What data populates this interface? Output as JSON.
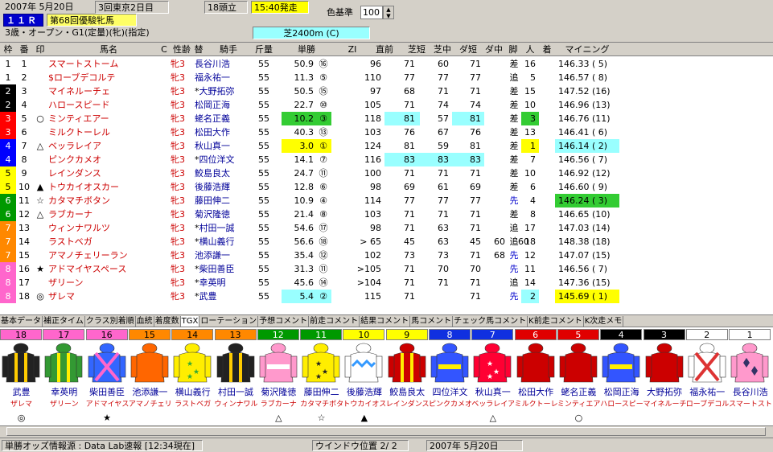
{
  "race_info": {
    "date": "2007年 5月20日",
    "meeting": "3回東京2日目",
    "race_no": "１１Ｒ",
    "race_name": "第68回優駿牝馬",
    "conditions": "3歳・オープン・G1(定量)(牝)(指定)",
    "field_size": "18頭立",
    "start_time": "15:40発走",
    "color_label": "色基準",
    "color_value": "100",
    "course": "芝2400m (C)"
  },
  "columns": [
    "枠",
    "番",
    "印",
    "馬名",
    "C",
    "性齢",
    "替",
    "騎手",
    "斤量",
    "単勝",
    "ZI",
    "直前",
    "芝短",
    "芝中",
    "ダ短",
    "ダ中",
    "脚",
    "人",
    "着",
    "マイニング"
  ],
  "horses": [
    {
      "waku": "1",
      "uma": "1",
      "mark": "",
      "name": "スマートストーム",
      "sexage": "牝3",
      "kae": "",
      "jockey": "長谷川浩",
      "kin": "55",
      "odds": "50.9",
      "pop_m": "⑯",
      "zi": "96",
      "c1": "71",
      "c2": "60",
      "c3": "71",
      "c4": "",
      "c5": "",
      "ky": "差",
      "pop": "16",
      "fin": "",
      "mining": "146.33 ( 5)"
    },
    {
      "waku": "1",
      "uma": "2",
      "mark": "",
      "name": "$ローブデコルテ",
      "sexage": "牝3",
      "kae": "",
      "jockey": "福永祐一",
      "kin": "55",
      "odds": "11.3",
      "pop_m": "⑤",
      "zi": "110",
      "c1": "77",
      "c2": "77",
      "c3": "77",
      "c4": "",
      "c5": "",
      "ky": "追",
      "pop": "5",
      "fin": "",
      "mining": "146.57 ( 8)"
    },
    {
      "waku": "2",
      "uma": "3",
      "mark": "",
      "name": "マイネルーチェ",
      "sexage": "牝3",
      "kae": "*",
      "jockey": "大野拓弥",
      "kin": "55",
      "odds": "50.5",
      "pop_m": "⑮",
      "zi": "97",
      "c1": "68",
      "c2": "71",
      "c3": "71",
      "c4": "",
      "c5": "",
      "ky": "差",
      "pop": "15",
      "fin": "",
      "mining": "147.52 (16)"
    },
    {
      "waku": "2",
      "uma": "4",
      "mark": "",
      "name": "ハロースピード",
      "sexage": "牝3",
      "kae": "",
      "jockey": "松岡正海",
      "kin": "55",
      "odds": "22.7",
      "pop_m": "⑩",
      "zi": "105",
      "c1": "71",
      "c2": "74",
      "c3": "74",
      "c4": "",
      "c5": "",
      "ky": "差",
      "pop": "10",
      "fin": "",
      "mining": "146.96 (13)"
    },
    {
      "waku": "3",
      "uma": "5",
      "mark": "○",
      "name": "ミンティエアー",
      "sexage": "牝3",
      "kae": "",
      "jockey": "蛯名正義",
      "kin": "55",
      "odds": "10.2",
      "pop_m": "③",
      "zi": "118",
      "c1": "81",
      "c2": "57",
      "c3": "81",
      "c4": "",
      "c5": "",
      "ky": "差",
      "pop": "3",
      "fin": "",
      "mining": "146.76 (11)"
    },
    {
      "waku": "3",
      "uma": "6",
      "mark": "",
      "name": "ミルクトーレル",
      "sexage": "牝3",
      "kae": "",
      "jockey": "松田大作",
      "kin": "55",
      "odds": "40.3",
      "pop_m": "⑬",
      "zi": "103",
      "c1": "76",
      "c2": "67",
      "c3": "76",
      "c4": "",
      "c5": "",
      "ky": "差",
      "pop": "13",
      "fin": "",
      "mining": "146.41 ( 6)"
    },
    {
      "waku": "4",
      "uma": "7",
      "mark": "△",
      "name": "ベッラレイア",
      "sexage": "牝3",
      "kae": "",
      "jockey": "秋山真一",
      "kin": "55",
      "odds": "3.0",
      "pop_m": "①",
      "zi": "124",
      "c1": "81",
      "c2": "59",
      "c3": "81",
      "c4": "",
      "c5": "",
      "ky": "差",
      "pop": "1",
      "fin": "",
      "mining": "146.14 ( 2)"
    },
    {
      "waku": "4",
      "uma": "8",
      "mark": "",
      "name": "ピンクカメオ",
      "sexage": "牝3",
      "kae": "*",
      "jockey": "四位洋文",
      "kin": "55",
      "odds": "14.1",
      "pop_m": "⑦",
      "zi": "116",
      "c1": "83",
      "c2": "83",
      "c3": "83",
      "c4": "",
      "c5": "",
      "ky": "差",
      "pop": "7",
      "fin": "",
      "mining": "146.56 ( 7)"
    },
    {
      "waku": "5",
      "uma": "9",
      "mark": "",
      "name": "レインダンス",
      "sexage": "牝3",
      "kae": "",
      "jockey": "鮫島良太",
      "kin": "55",
      "odds": "24.7",
      "pop_m": "⑪",
      "zi": "100",
      "c1": "71",
      "c2": "71",
      "c3": "71",
      "c4": "",
      "c5": "",
      "ky": "差",
      "pop": "10",
      "fin": "",
      "mining": "146.92 (12)"
    },
    {
      "waku": "5",
      "uma": "10",
      "mark": "▲",
      "name": "トウカイオスカー",
      "sexage": "牝3",
      "kae": "",
      "jockey": "後藤浩輝",
      "kin": "55",
      "odds": "12.8",
      "pop_m": "⑥",
      "zi": "98",
      "c1": "69",
      "c2": "61",
      "c3": "69",
      "c4": "",
      "c5": "",
      "ky": "差",
      "pop": "6",
      "fin": "",
      "mining": "146.60 ( 9)"
    },
    {
      "waku": "6",
      "uma": "11",
      "mark": "☆",
      "name": "カタマチボタン",
      "sexage": "牝3",
      "kae": "",
      "jockey": "藤田伸二",
      "kin": "55",
      "odds": "10.9",
      "pop_m": "④",
      "zi": "114",
      "c1": "77",
      "c2": "77",
      "c3": "77",
      "c4": "",
      "c5": "",
      "ky": "先",
      "pop": "4",
      "fin": "",
      "mining": "146.24 ( 3)"
    },
    {
      "waku": "6",
      "uma": "12",
      "mark": "△",
      "name": "ラブカーナ",
      "sexage": "牝3",
      "kae": "",
      "jockey": "菊沢隆徳",
      "kin": "55",
      "odds": "21.4",
      "pop_m": "⑧",
      "zi": "103",
      "c1": "71",
      "c2": "71",
      "c3": "71",
      "c4": "",
      "c5": "",
      "ky": "差",
      "pop": "8",
      "fin": "",
      "mining": "146.65 (10)"
    },
    {
      "waku": "7",
      "uma": "13",
      "mark": "",
      "name": "ウィンナワルツ",
      "sexage": "牝3",
      "kae": "*",
      "jockey": "村田一誠",
      "kin": "55",
      "odds": "54.6",
      "pop_m": "⑰",
      "zi": "98",
      "c1": "71",
      "c2": "63",
      "c3": "71",
      "c4": "",
      "c5": "",
      "ky": "追",
      "pop": "17",
      "fin": "",
      "mining": "147.03 (14)"
    },
    {
      "waku": "7",
      "uma": "14",
      "mark": "",
      "name": "ラストベガ",
      "sexage": "牝3",
      "kae": "*",
      "jockey": "横山義行",
      "kin": "55",
      "odds": "56.6",
      "pop_m": "⑱",
      "zi": "> 65",
      "c1": "45",
      "c2": "63",
      "c3": "45",
      "c4": "60",
      "c5": "60",
      "ky": "追",
      "pop": "18",
      "fin": "",
      "mining": "148.38 (18)"
    },
    {
      "waku": "7",
      "uma": "15",
      "mark": "",
      "name": "アマノチェリーラン",
      "sexage": "牝3",
      "kae": "",
      "jockey": "池添謙一",
      "kin": "55",
      "odds": "35.4",
      "pop_m": "⑫",
      "zi": "102",
      "c1": "73",
      "c2": "73",
      "c3": "71",
      "c4": "68",
      "c5": "",
      "ky": "先",
      "pop": "12",
      "fin": "",
      "mining": "147.07 (15)"
    },
    {
      "waku": "8",
      "uma": "16",
      "mark": "★",
      "name": "アドマイヤスペース",
      "sexage": "牝3",
      "kae": "*",
      "jockey": "柴田善臣",
      "kin": "55",
      "odds": "31.3",
      "pop_m": "⑪",
      "zi": ">105",
      "c1": "71",
      "c2": "70",
      "c3": "70",
      "c4": "",
      "c5": "",
      "ky": "先",
      "pop": "11",
      "fin": "",
      "mining": "146.56 ( 7)"
    },
    {
      "waku": "8",
      "uma": "17",
      "mark": "",
      "name": "ザリーン",
      "sexage": "牝3",
      "kae": "*",
      "jockey": "幸英明",
      "kin": "55",
      "odds": "45.6",
      "pop_m": "⑭",
      "zi": ">104",
      "c1": "71",
      "c2": "71",
      "c3": "71",
      "c4": "",
      "c5": "",
      "ky": "追",
      "pop": "14",
      "fin": "",
      "mining": "147.36 (15)"
    },
    {
      "waku": "8",
      "uma": "18",
      "mark": "◎",
      "name": "ザレマ",
      "sexage": "牝3",
      "kae": "*",
      "jockey": "武豊",
      "kin": "55",
      "odds": "5.4",
      "pop_m": "②",
      "zi": "115",
      "c1": "71",
      "c2": "",
      "c3": "71",
      "c4": "",
      "c5": "",
      "ky": "先",
      "pop": "2",
      "fin": "",
      "mining": "145.69 ( 1)"
    }
  ],
  "tabs": [
    "基本データ",
    "補正タイム",
    "クラス別着順",
    "血統",
    "着度数",
    "TGX",
    "ローテーション",
    "予想コメント",
    "前走コメント",
    "結果コメント",
    "馬コメント",
    "チェック馬コメント",
    "K前走コメント",
    "K次走メモ"
  ],
  "silks": [
    {
      "num": "18",
      "jockey": "武豊",
      "horse": "ザレマ",
      "mark": "◎"
    },
    {
      "num": "17",
      "jockey": "幸英明",
      "horse": "ザリーン",
      "mark": ""
    },
    {
      "num": "16",
      "jockey": "柴田善臣",
      "horse": "アドマイヤス",
      "mark": "★"
    },
    {
      "num": "15",
      "jockey": "池添謙一",
      "horse": "アマノチェリ",
      "mark": ""
    },
    {
      "num": "14",
      "jockey": "横山義行",
      "horse": "ラストベガ",
      "mark": ""
    },
    {
      "num": "13",
      "jockey": "村田一誠",
      "horse": "ウィンナワル",
      "mark": ""
    },
    {
      "num": "12",
      "jockey": "菊沢隆徳",
      "horse": "ラブカーナ",
      "mark": "△"
    },
    {
      "num": "11",
      "jockey": "藤田伸二",
      "horse": "カタマチボタ",
      "mark": "☆"
    },
    {
      "num": "10",
      "jockey": "後藤浩輝",
      "horse": "トウカイオス",
      "mark": "▲"
    },
    {
      "num": "9",
      "jockey": "鮫島良太",
      "horse": "レインダンス",
      "mark": ""
    },
    {
      "num": "8",
      "jockey": "四位洋文",
      "horse": "ピンクカメオ",
      "mark": ""
    },
    {
      "num": "7",
      "jockey": "秋山真一",
      "horse": "ベッラレイア",
      "mark": "△"
    },
    {
      "num": "6",
      "jockey": "松田大作",
      "horse": "ミルクトーレ",
      "mark": ""
    },
    {
      "num": "5",
      "jockey": "蛯名正義",
      "horse": "ミンティエア",
      "mark": "○"
    },
    {
      "num": "4",
      "jockey": "松岡正海",
      "horse": "ハロースピー",
      "mark": ""
    },
    {
      "num": "3",
      "jockey": "大野拓弥",
      "horse": "マイネルーチ",
      "mark": ""
    },
    {
      "num": "2",
      "jockey": "福永祐一",
      "horse": "ローブデコル",
      "mark": ""
    },
    {
      "num": "1",
      "jockey": "長谷川浩",
      "horse": "スマートスト",
      "mark": ""
    }
  ],
  "status": {
    "source": "単勝オッズ情報源 : Data Lab速報 [12:34現在]",
    "window_pos": "ウインドウ位置 2/ 2",
    "date": "2007年 5月20日"
  },
  "colors": {
    "waku1": "#ffffff",
    "waku2": "#000000",
    "waku3": "#ff0000",
    "waku4": "#0000ff",
    "waku5": "#ffff00",
    "waku6": "#009900",
    "waku7": "#ff8800",
    "waku8": "#ff66cc",
    "highlight_yellow": "#ffff00",
    "highlight_green": "#33cc33",
    "highlight_cyan": "#99ffff"
  }
}
